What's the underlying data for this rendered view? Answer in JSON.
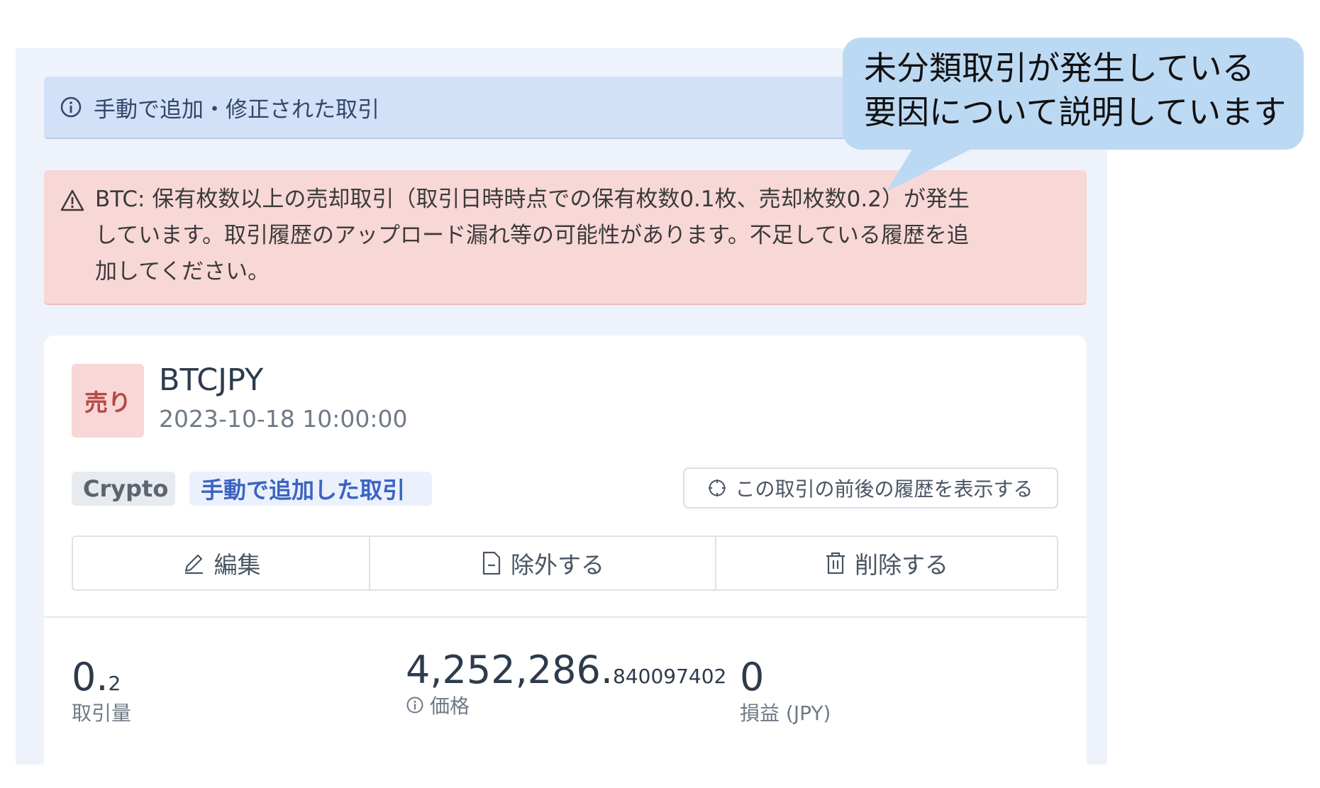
{
  "info_banner": {
    "text": "手動で追加・修正された取引",
    "icon": "info-circle-icon"
  },
  "warning_banner": {
    "icon": "warning-triangle-icon",
    "text": "BTC: 保有枚数以上の売却取引（取引日時時点での保有枚数0.1枚、売却枚数0.2）が発生\nしています。取引履歴のアップロード漏れ等の可能性があります。不足している履歴を追\n加してください。"
  },
  "transaction": {
    "side": "売り",
    "pair": "BTCJPY",
    "datetime": "2023-10-18 10:00:00",
    "tags": [
      "Crypto",
      "手動で追加した取引"
    ],
    "history_button": "この取引の前後の履歴を表示する",
    "actions": {
      "edit": "編集",
      "exclude": "除外する",
      "delete": "削除する"
    },
    "stats": {
      "amount": {
        "int": "0.",
        "dec": "2",
        "label": "取引量"
      },
      "price": {
        "int": "4,252,286.",
        "dec": "840097402",
        "label": "価格"
      },
      "pnl": {
        "value": "0",
        "label": "損益 (JPY)"
      }
    }
  },
  "callout": {
    "text": "未分類取引が発生している\n要因について説明しています"
  },
  "colors": {
    "info_bg": "#d3e1f8",
    "warn_bg": "#f8d7d7",
    "sell_badge": "#b54a44",
    "callout_bg": "#bcd9f3"
  }
}
